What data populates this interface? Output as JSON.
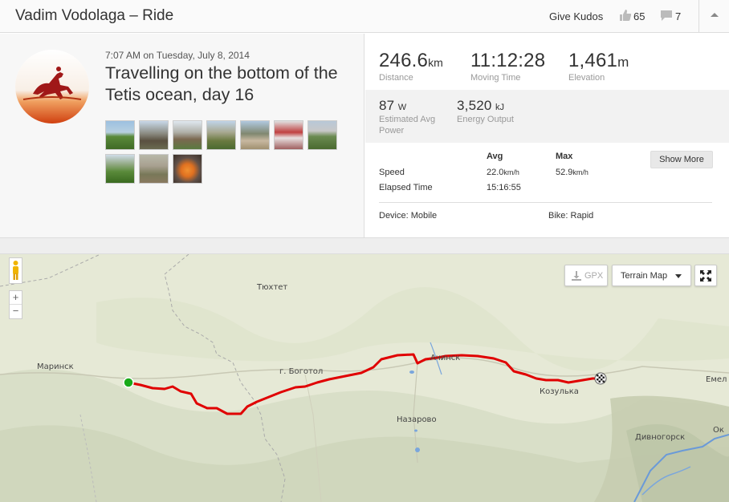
{
  "header": {
    "title": "Vadim Vodolaga – Ride",
    "give_kudos": "Give Kudos",
    "kudos_count": "65",
    "comment_count": "7"
  },
  "activity": {
    "date": "7:07 AM on Tuesday, July 8, 2014",
    "name": "Travelling on the bottom of the Tetis ocean, day 16"
  },
  "stats": {
    "distance": {
      "value": "246.6",
      "unit": "km",
      "label": "Distance"
    },
    "moving_time": {
      "value": "11:12:28",
      "label": "Moving Time"
    },
    "elevation": {
      "value": "1,461",
      "unit": "m",
      "label": "Elevation"
    },
    "power": {
      "value": "87",
      "unit": "W",
      "label_line1": "Estimated Avg",
      "label_line2": "Power"
    },
    "energy": {
      "value": "3,520",
      "unit": "kJ",
      "label": "Energy Output"
    }
  },
  "table": {
    "col_avg": "Avg",
    "col_max": "Max",
    "speed_label": "Speed",
    "speed_avg": "22.0",
    "speed_max": "52.9",
    "speed_unit": "km/h",
    "elapsed_label": "Elapsed Time",
    "elapsed_avg": "15:16:55",
    "show_more": "Show More"
  },
  "device": {
    "device": "Device: Mobile",
    "bike": "Bike: Rapid"
  },
  "map": {
    "gpx": "GPX",
    "map_type": "Terrain Map",
    "zoom_in": "+",
    "zoom_out": "−",
    "labels": {
      "tyukhtet": "Тюхтет",
      "mariinsk": "Маринск",
      "bogotol": "г. Боготол",
      "achinsk": "Ачинск",
      "kozulka": "Козулька",
      "nazarovo": "Назарово",
      "divnogorsk": "Дивногорск",
      "emel": "Емел",
      "ok": "Ок"
    }
  },
  "colors": {
    "route": "#e00000",
    "start": "#1aaa1a"
  }
}
